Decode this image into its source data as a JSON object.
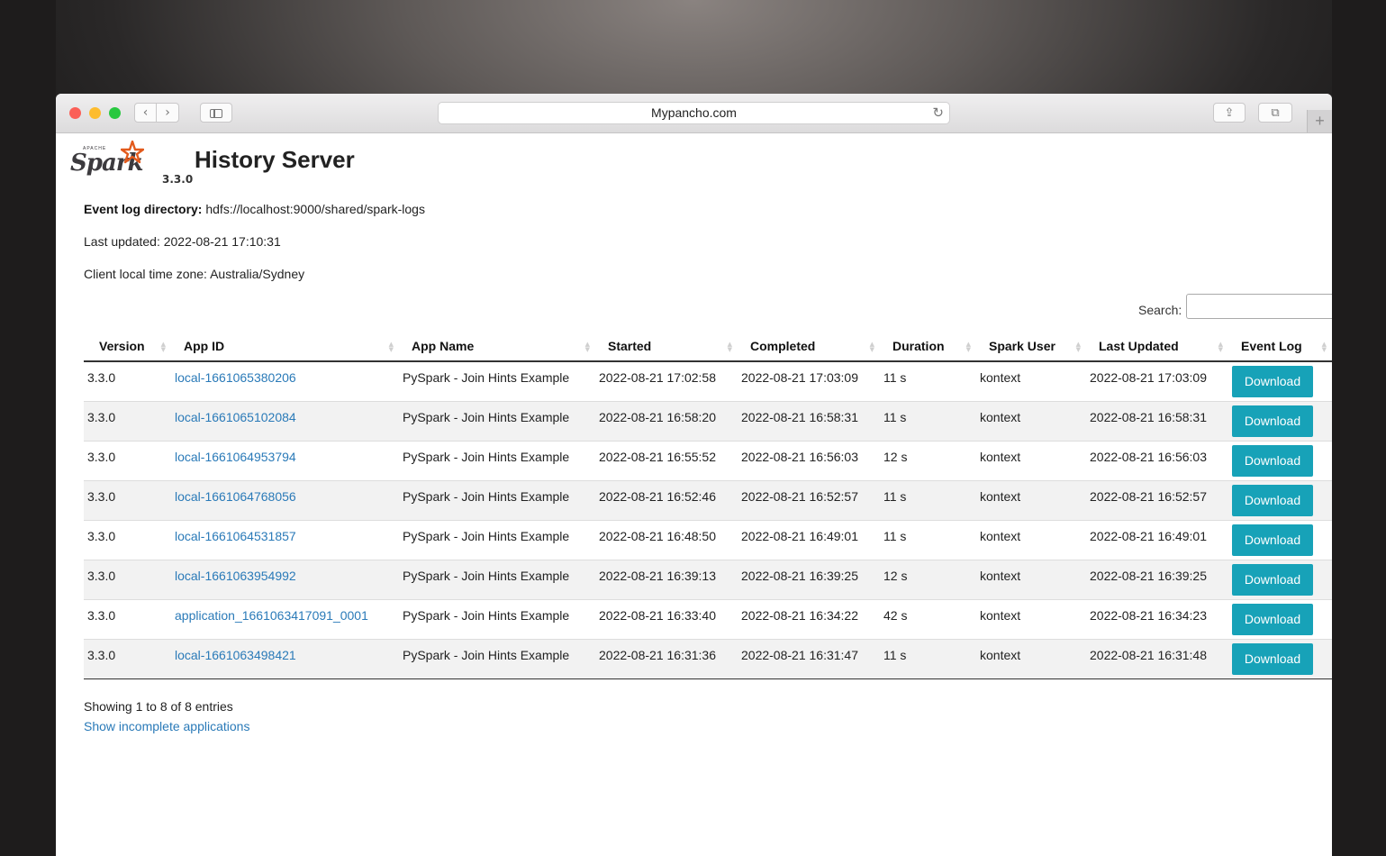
{
  "browser": {
    "url": "Mypancho.com",
    "back_icon": "‹",
    "forward_icon": "›",
    "reload_icon": "↻",
    "share_icon": "⇪",
    "tabs_icon": "⧉",
    "newtab_icon": "+"
  },
  "header": {
    "logo_text": "Spark",
    "logo_apache": "APACHE",
    "version": "3.3.0",
    "title": "History Server"
  },
  "info": {
    "event_log_label": "Event log directory:",
    "event_log_value": "hdfs://localhost:9000/shared/spark-logs",
    "last_updated": "Last updated: 2022-08-21 17:10:31",
    "timezone": "Client local time zone: Australia/Sydney"
  },
  "search": {
    "label": "Search:",
    "value": ""
  },
  "table": {
    "columns": [
      "Version",
      "App ID",
      "App Name",
      "Started",
      "Completed",
      "Duration",
      "Spark User",
      "Last Updated",
      "Event Log"
    ],
    "rows": [
      {
        "version": "3.3.0",
        "app_id": "local-1661065380206",
        "app_name": "PySpark - Join Hints Example",
        "started": "2022-08-21 17:02:58",
        "completed": "2022-08-21 17:03:09",
        "duration": "11 s",
        "user": "kontext",
        "last_updated": "2022-08-21 17:03:09",
        "event_log": "Download"
      },
      {
        "version": "3.3.0",
        "app_id": "local-1661065102084",
        "app_name": "PySpark - Join Hints Example",
        "started": "2022-08-21 16:58:20",
        "completed": "2022-08-21 16:58:31",
        "duration": "11 s",
        "user": "kontext",
        "last_updated": "2022-08-21 16:58:31",
        "event_log": "Download"
      },
      {
        "version": "3.3.0",
        "app_id": "local-1661064953794",
        "app_name": "PySpark - Join Hints Example",
        "started": "2022-08-21 16:55:52",
        "completed": "2022-08-21 16:56:03",
        "duration": "12 s",
        "user": "kontext",
        "last_updated": "2022-08-21 16:56:03",
        "event_log": "Download"
      },
      {
        "version": "3.3.0",
        "app_id": "local-1661064768056",
        "app_name": "PySpark - Join Hints Example",
        "started": "2022-08-21 16:52:46",
        "completed": "2022-08-21 16:52:57",
        "duration": "11 s",
        "user": "kontext",
        "last_updated": "2022-08-21 16:52:57",
        "event_log": "Download"
      },
      {
        "version": "3.3.0",
        "app_id": "local-1661064531857",
        "app_name": "PySpark - Join Hints Example",
        "started": "2022-08-21 16:48:50",
        "completed": "2022-08-21 16:49:01",
        "duration": "11 s",
        "user": "kontext",
        "last_updated": "2022-08-21 16:49:01",
        "event_log": "Download"
      },
      {
        "version": "3.3.0",
        "app_id": "local-1661063954992",
        "app_name": "PySpark - Join Hints Example",
        "started": "2022-08-21 16:39:13",
        "completed": "2022-08-21 16:39:25",
        "duration": "12 s",
        "user": "kontext",
        "last_updated": "2022-08-21 16:39:25",
        "event_log": "Download"
      },
      {
        "version": "3.3.0",
        "app_id": "application_1661063417091_0001",
        "app_name": "PySpark - Join Hints Example",
        "started": "2022-08-21 16:33:40",
        "completed": "2022-08-21 16:34:22",
        "duration": "42 s",
        "user": "kontext",
        "last_updated": "2022-08-21 16:34:23",
        "event_log": "Download"
      },
      {
        "version": "3.3.0",
        "app_id": "local-1661063498421",
        "app_name": "PySpark - Join Hints Example",
        "started": "2022-08-21 16:31:36",
        "completed": "2022-08-21 16:31:47",
        "duration": "11 s",
        "user": "kontext",
        "last_updated": "2022-08-21 16:31:48",
        "event_log": "Download"
      }
    ]
  },
  "footer": {
    "entries_info": "Showing 1 to 8 of 8 entries",
    "incomplete_link": "Show incomplete applications"
  },
  "colors": {
    "link": "#2a7ab8",
    "download_button": "#17a2b8",
    "logo_star": "#e25a1c"
  }
}
